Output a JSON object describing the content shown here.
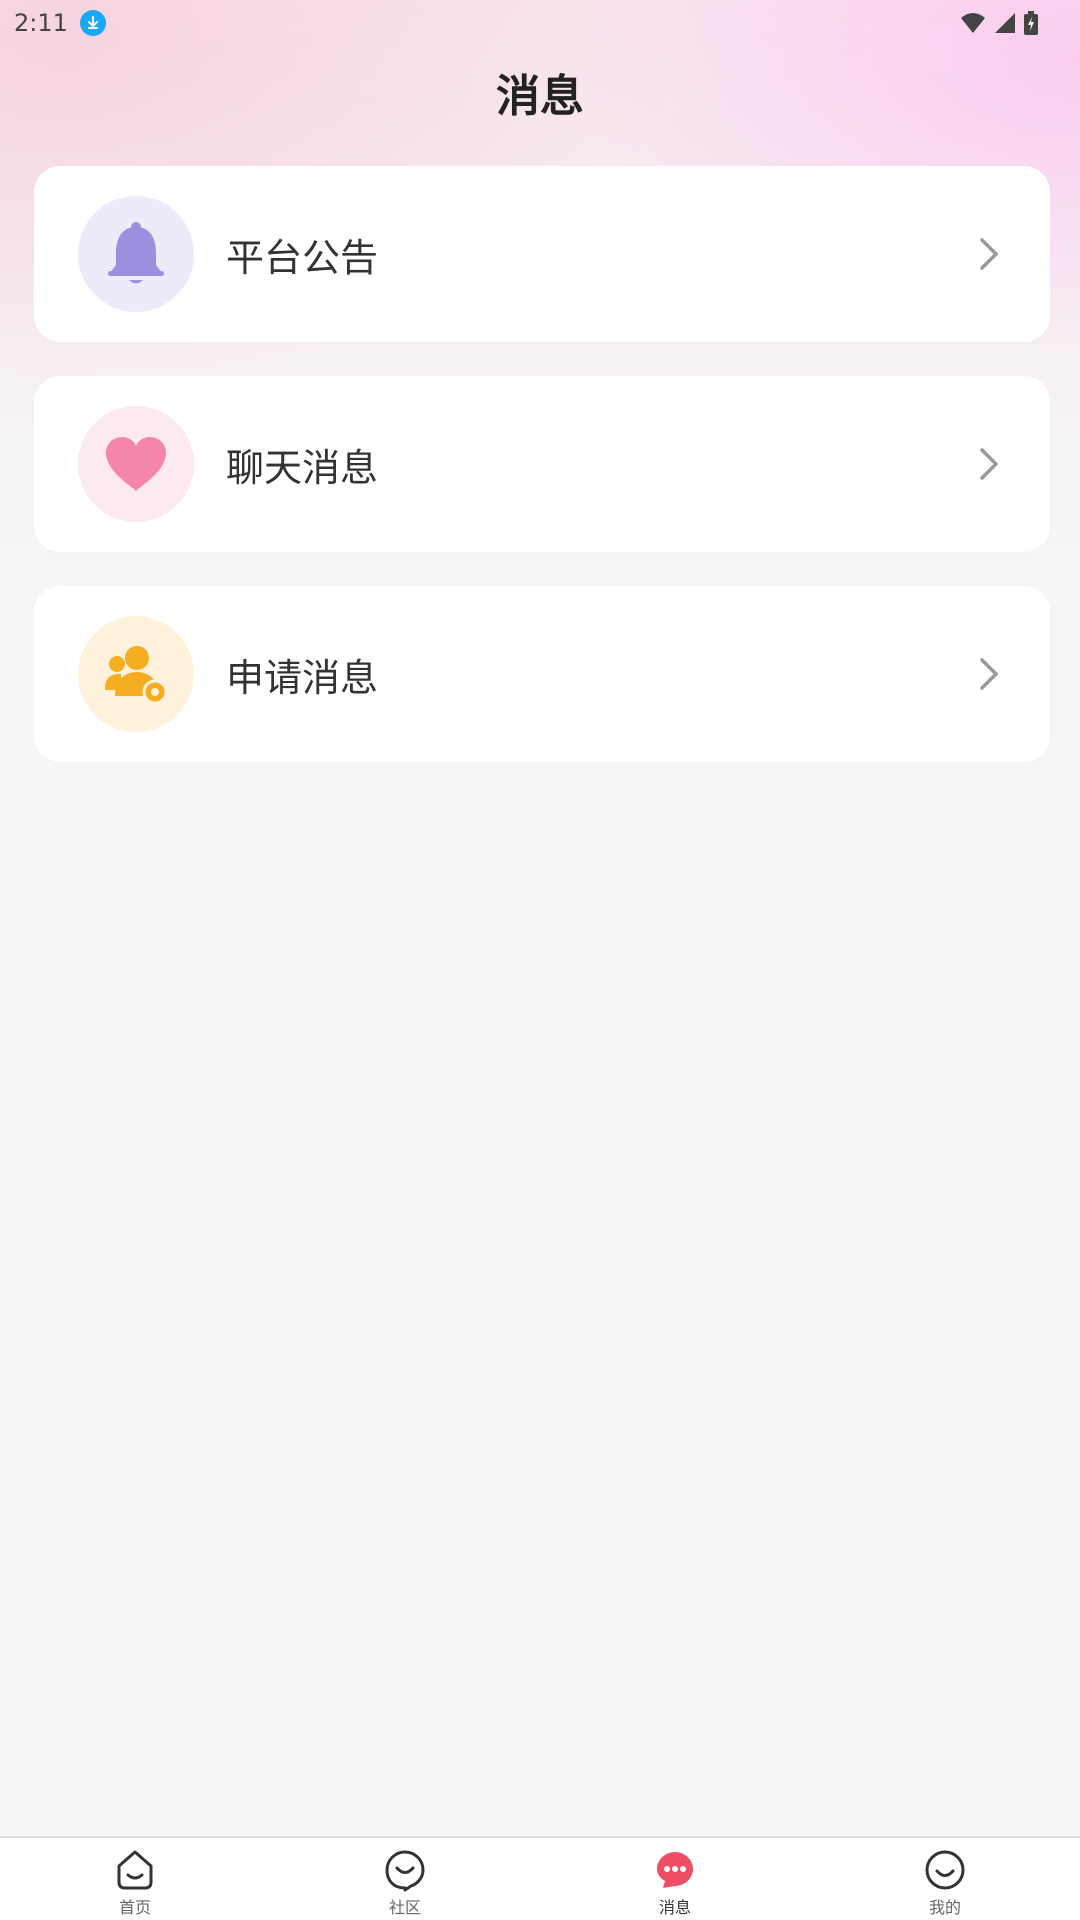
{
  "status_bar": {
    "time": "2:11"
  },
  "header": {
    "title": "消息"
  },
  "menu": [
    {
      "label": "平台公告",
      "icon": "bell-icon",
      "color": "#9b8fdf"
    },
    {
      "label": "聊天消息",
      "icon": "heart-icon",
      "color": "#f486ad"
    },
    {
      "label": "申请消息",
      "icon": "user-add-icon",
      "color": "#f7ad22"
    }
  ],
  "bottom_nav": [
    {
      "label": "首页",
      "icon": "home-icon",
      "active": false
    },
    {
      "label": "社区",
      "icon": "community-icon",
      "active": false
    },
    {
      "label": "消息",
      "icon": "message-icon",
      "active": true,
      "color": "#f04e64"
    },
    {
      "label": "我的",
      "icon": "profile-icon",
      "active": false
    }
  ]
}
